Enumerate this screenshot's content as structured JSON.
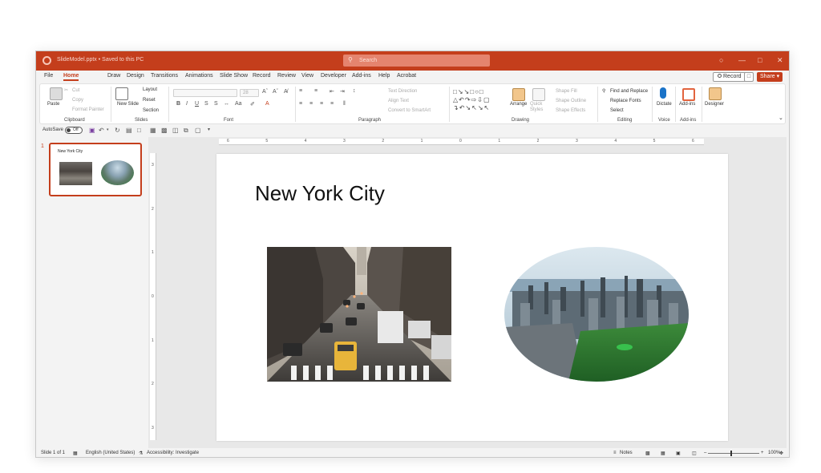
{
  "titlebar": {
    "document": "SlideModel.pptx • Saved to this PC",
    "search_placeholder": "Search"
  },
  "menu": {
    "tabs": [
      "File",
      "Home",
      "Draw",
      "Design",
      "Transitions",
      "Animations",
      "Slide Show",
      "Record",
      "Review",
      "View",
      "Developer",
      "Add-ins",
      "Help",
      "Acrobat"
    ],
    "active": "Home",
    "record_label": "Record",
    "share_label": "Share"
  },
  "ribbon": {
    "clipboard": {
      "paste": "Paste",
      "cut": "Cut",
      "copy": "Copy",
      "format_painter": "Format Painter",
      "label": "Clipboard"
    },
    "slides": {
      "new_slide": "New Slide",
      "layout": "Layout",
      "reset": "Reset",
      "section": "Section",
      "label": "Slides"
    },
    "font": {
      "font_size": "28",
      "label": "Font"
    },
    "paragraph": {
      "text_direction": "Text Direction",
      "align_text": "Align Text",
      "convert_smartart": "Convert to SmartArt",
      "label": "Paragraph"
    },
    "drawing": {
      "arrange": "Arrange",
      "quick_styles": "Quick Styles",
      "shape_fill": "Shape Fill",
      "shape_outline": "Shape Outline",
      "shape_effects": "Shape Effects",
      "label": "Drawing"
    },
    "editing": {
      "find_replace": "Find and Replace",
      "replace_fonts": "Replace Fonts",
      "select": "Select",
      "label": "Editing"
    },
    "voice": {
      "dictate": "Dictate",
      "label": "Voice"
    },
    "addins": {
      "addins": "Add-ins",
      "label": "Add-ins"
    },
    "designer": {
      "designer": "Designer"
    }
  },
  "qat": {
    "autosave": "AutoSave",
    "toggle": "Off"
  },
  "thumbnails": [
    {
      "number": "1",
      "title": "New York City"
    }
  ],
  "ruler": {
    "h_ticks": [
      "6",
      "5",
      "4",
      "3",
      "2",
      "1",
      "0",
      "1",
      "2",
      "3",
      "4",
      "5",
      "6"
    ],
    "v_ticks": [
      "3",
      "2",
      "1",
      "0",
      "1",
      "2",
      "3"
    ]
  },
  "slide": {
    "title": "New York City"
  },
  "status": {
    "slide": "Slide 1 of 1",
    "language": "English (United States)",
    "accessibility": "Accessibility: Investigate",
    "notes": "Notes",
    "zoom": "100%"
  },
  "colors": {
    "accent": "#c43e1c"
  }
}
